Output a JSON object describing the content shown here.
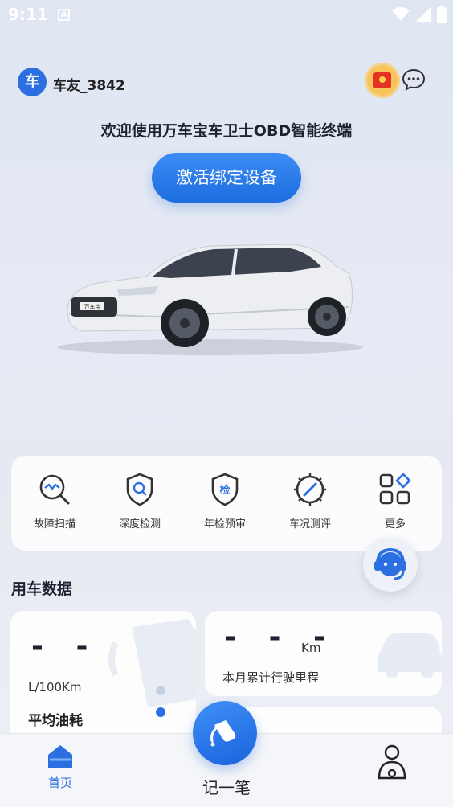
{
  "status_bar": {
    "time": "9:11",
    "notification_badge": "A"
  },
  "header": {
    "avatar_text": "车",
    "username": "车友_3842",
    "icons": [
      "red-packet-icon",
      "chat-bubble-icon"
    ]
  },
  "welcome": {
    "title": "欢迎使用万车宝车卫士OBD智能终端",
    "activate_button": "激活绑定设备"
  },
  "car_image": {
    "plate_text": "万车宝"
  },
  "functions": [
    {
      "label": "故障扫描",
      "icon": "scan-magnifier-icon"
    },
    {
      "label": "深度检测",
      "icon": "shield-search-icon"
    },
    {
      "label": "年检预审",
      "icon": "shield-check-icon",
      "icon_text": "检"
    },
    {
      "label": "车况测评",
      "icon": "gauge-icon"
    },
    {
      "label": "更多",
      "icon": "grid-more-icon"
    }
  ],
  "usage_section": {
    "title": "用车数据",
    "fuel_card": {
      "value": "- -",
      "unit": "L/100Km",
      "name": "平均油耗"
    },
    "mileage_card": {
      "value": "- - -",
      "unit": "Km",
      "name": "本月累计行驶里程"
    }
  },
  "bottom_nav": {
    "home_label": "首页",
    "center_label": "记一笔",
    "profile_icon": "user-icon"
  },
  "colors": {
    "primary": "#2b6fe0",
    "accent_gold": "#f7c35a",
    "red": "#e53124"
  }
}
